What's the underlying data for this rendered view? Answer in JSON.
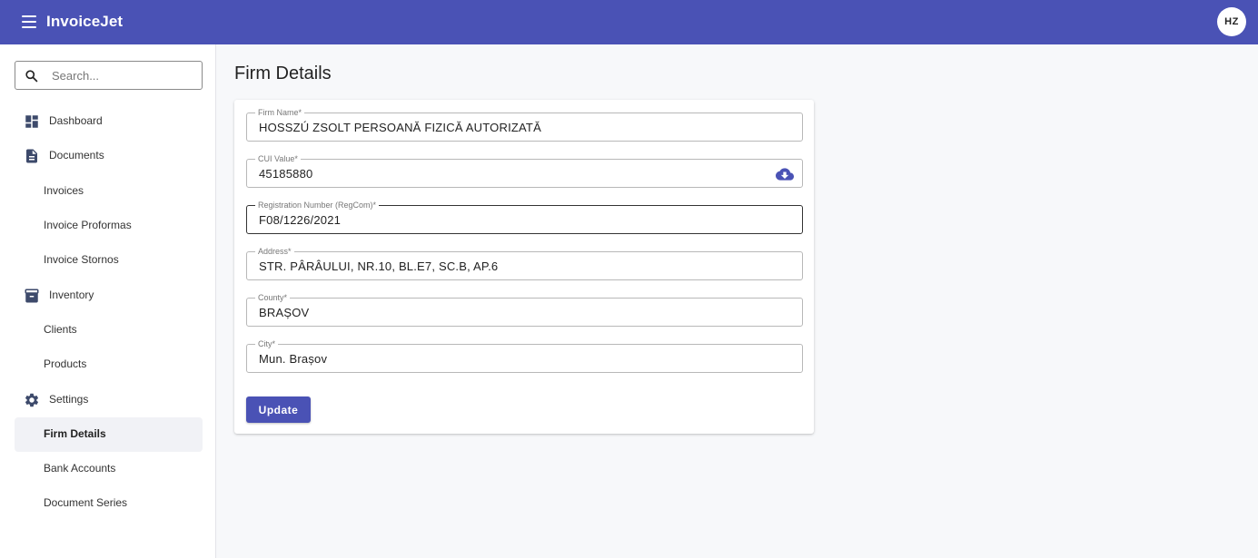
{
  "app": {
    "title": "InvoiceJet",
    "avatar_initials": "HZ",
    "accent": "#4a52b5"
  },
  "sidebar": {
    "search_placeholder": "Search...",
    "items": [
      {
        "label": "Dashboard",
        "icon": "dashboard-icon"
      },
      {
        "label": "Documents",
        "icon": "document-icon"
      },
      {
        "label": "Invoices"
      },
      {
        "label": "Invoice Proformas"
      },
      {
        "label": "Invoice Stornos"
      },
      {
        "label": "Inventory",
        "icon": "inventory-icon"
      },
      {
        "label": "Clients"
      },
      {
        "label": "Products"
      },
      {
        "label": "Settings",
        "icon": "gear-icon"
      },
      {
        "label": "Firm Details",
        "active": true
      },
      {
        "label": "Bank Accounts"
      },
      {
        "label": "Document Series"
      }
    ]
  },
  "main": {
    "title": "Firm Details",
    "fields": [
      {
        "label": "Firm Name*",
        "value": "HOSSZÚ ZSOLT PERSOANĂ FIZICĂ AUTORIZATĂ"
      },
      {
        "label": "CUI Value*",
        "value": "45185880",
        "icon": "cloud-download-icon"
      },
      {
        "label": "Registration Number (RegCom)*",
        "value": "F08/1226/2021"
      },
      {
        "label": "Address*",
        "value": "STR. PÂRÂULUI, NR.10, BL.E7, SC.B, AP.6"
      },
      {
        "label": "County*",
        "value": "BRAȘOV"
      },
      {
        "label": "City*",
        "value": "Mun. Brașov"
      }
    ],
    "update_label": "Update"
  }
}
